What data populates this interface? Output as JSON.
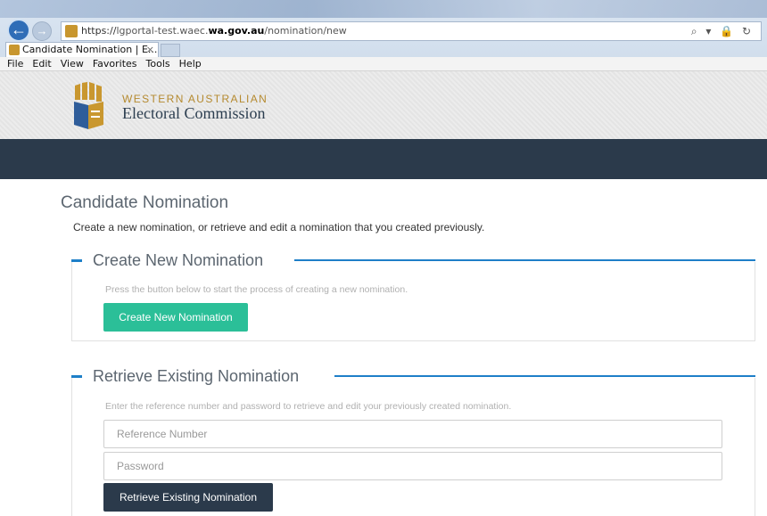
{
  "browser": {
    "url_scheme": "https://",
    "url_host_prefix": "lgportal-test.waec.",
    "url_host": "wa.gov.au",
    "url_path": "/nomination/new",
    "url_icons": "⌕ ▾ 🔒 ↻",
    "tab_title": "Candidate Nomination | E...",
    "tab_close": "×",
    "menu": [
      "File",
      "Edit",
      "View",
      "Favorites",
      "Tools",
      "Help"
    ]
  },
  "site": {
    "brand_line1": "WESTERN AUSTRALIAN",
    "brand_line2": "Electoral Commission"
  },
  "page": {
    "title": "Candidate Nomination",
    "subtitle": "Create a new nomination, or retrieve and edit a nomination that you created previously."
  },
  "create_section": {
    "legend": "Create New Nomination",
    "help_text": "Press the button below to start the process of creating a new nomination.",
    "button_label": "Create New Nomination"
  },
  "retrieve_section": {
    "legend": "Retrieve Existing Nomination",
    "help_text": "Enter the reference number and password to retrieve and edit your previously created nomination.",
    "reference_placeholder": "Reference Number",
    "password_placeholder": "Password",
    "button_label": "Retrieve Existing Nomination"
  },
  "colors": {
    "accent_blue": "#1e7fc8",
    "create_button": "#2bbf98",
    "navy": "#2b3a4b",
    "brand_gold": "#b58a2f"
  }
}
